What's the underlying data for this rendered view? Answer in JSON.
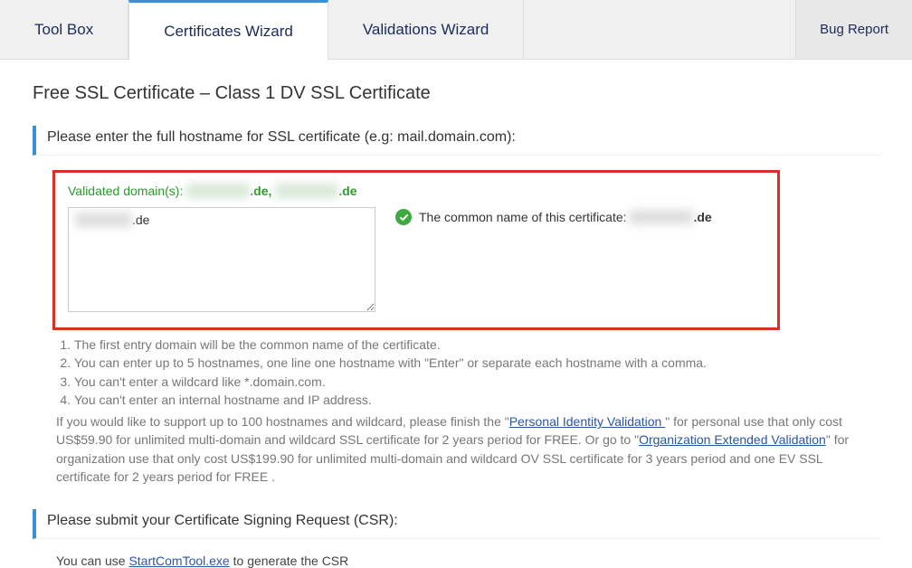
{
  "tabs": {
    "toolbox": "Tool Box",
    "cert_wizard": "Certificates Wizard",
    "val_wizard": "Validations Wizard",
    "bug_report": "Bug Report"
  },
  "page_title": "Free SSL Certificate – Class 1 DV SSL Certificate",
  "section_hostname": "Please enter the full hostname for SSL certificate (e.g: mail.domain.com):",
  "validated_label": "Validated domain(s): ",
  "validated_d1_blur": "xxxxxxxxxx",
  "validated_d1_suffix": ".de, ",
  "validated_d2_blur": "xxxxxxxxxx",
  "validated_d2_suffix": ".de",
  "hostname_value_blur": "xxxxxxxxx",
  "hostname_value_suffix": ".de",
  "common_name_prefix": "The common name of this certificate: ",
  "common_name_blur": "xxxxxxxxxx",
  "common_name_suffix": ".de",
  "notes": {
    "n1": "The first entry domain will be the common name of the certificate.",
    "n2": "You can enter up to 5 hostnames, one line one hostname with \"Enter\" or separate each hostname with a comma.",
    "n3": "You can't enter a wildcard like *.domain.com.",
    "n4": "You can't enter an internal hostname and IP address.",
    "para_a": "If you would like to support up to 100 hostnames and wildcard, please finish the \"",
    "link_piv": "Personal Identity Validation ",
    "para_b": "\" for personal use that only cost US$59.90 for unlimited multi-domain and wildcard SSL certificate for 2 years period for FREE. Or go to \"",
    "link_oev": "Organization Extended Validation",
    "para_c": "\" for organization use that only cost US$199.90 for unlimited multi-domain and wildcard OV SSL certificate for 3 years period and one EV SSL certificate for 2 years period for FREE ."
  },
  "section_csr": "Please submit your Certificate Signing Request (CSR):",
  "csr_line_a": "You can use ",
  "csr_link": "StartComTool.exe",
  "csr_line_b": " to generate the CSR"
}
